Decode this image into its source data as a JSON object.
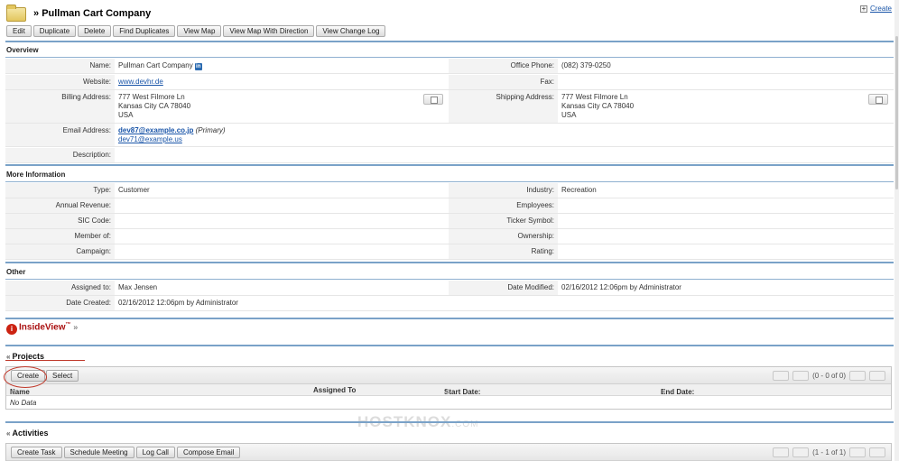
{
  "header": {
    "title": "Pullman Cart Company",
    "create_label": "Create"
  },
  "toolbar": [
    "Edit",
    "Duplicate",
    "Delete",
    "Find Duplicates",
    "View Map",
    "View Map With Direction",
    "View Change Log"
  ],
  "overview": {
    "title": "Overview",
    "name_label": "Name:",
    "name": "Pullman Cart Company",
    "office_phone_label": "Office Phone:",
    "office_phone": "(082) 379-0250",
    "website_label": "Website:",
    "website": "www.devhr.de",
    "fax_label": "Fax:",
    "billing_label": "Billing Address:",
    "billing": [
      "777 West Filmore Ln",
      "Kansas City CA  78040",
      "USA"
    ],
    "shipping_label": "Shipping Address:",
    "shipping": [
      "777 West Filmore Ln",
      "Kansas City CA  78040",
      "USA"
    ],
    "email_label": "Email Address:",
    "email_primary": "dev87@example.co.jp",
    "primary_tag": "(Primary)",
    "email_secondary": "dev71@example.us",
    "description_label": "Description:"
  },
  "more_info": {
    "title": "More Information",
    "type_label": "Type:",
    "type": "Customer",
    "industry_label": "Industry:",
    "industry": "Recreation",
    "annual_revenue_label": "Annual Revenue:",
    "employees_label": "Employees:",
    "sic_label": "SIC Code:",
    "ticker_label": "Ticker Symbol:",
    "member_label": "Member of:",
    "ownership_label": "Ownership:",
    "campaign_label": "Campaign:",
    "rating_label": "Rating:"
  },
  "other": {
    "title": "Other",
    "assigned_label": "Assigned to:",
    "assigned": "Max Jensen",
    "modified_label": "Date Modified:",
    "modified": "02/16/2012 12:06pm by Administrator",
    "created_label": "Date Created:",
    "created": "02/16/2012 12:06pm by Administrator"
  },
  "insideview": {
    "label": "InsideView",
    "tm": "™"
  },
  "projects": {
    "title": "Projects",
    "buttons": [
      "Create",
      "Select"
    ],
    "pager": "(0 - 0 of 0)",
    "columns": [
      "Name",
      "Assigned To",
      "Start Date:",
      "End Date:"
    ],
    "empty": "No Data"
  },
  "activities": {
    "title": "Activities",
    "buttons": [
      "Create Task",
      "Schedule Meeting",
      "Log Call",
      "Compose Email"
    ],
    "pager": "(1 - 1 of 1)"
  },
  "watermark": {
    "brand": "HOSTKNOX",
    "suffix": ".COM"
  }
}
